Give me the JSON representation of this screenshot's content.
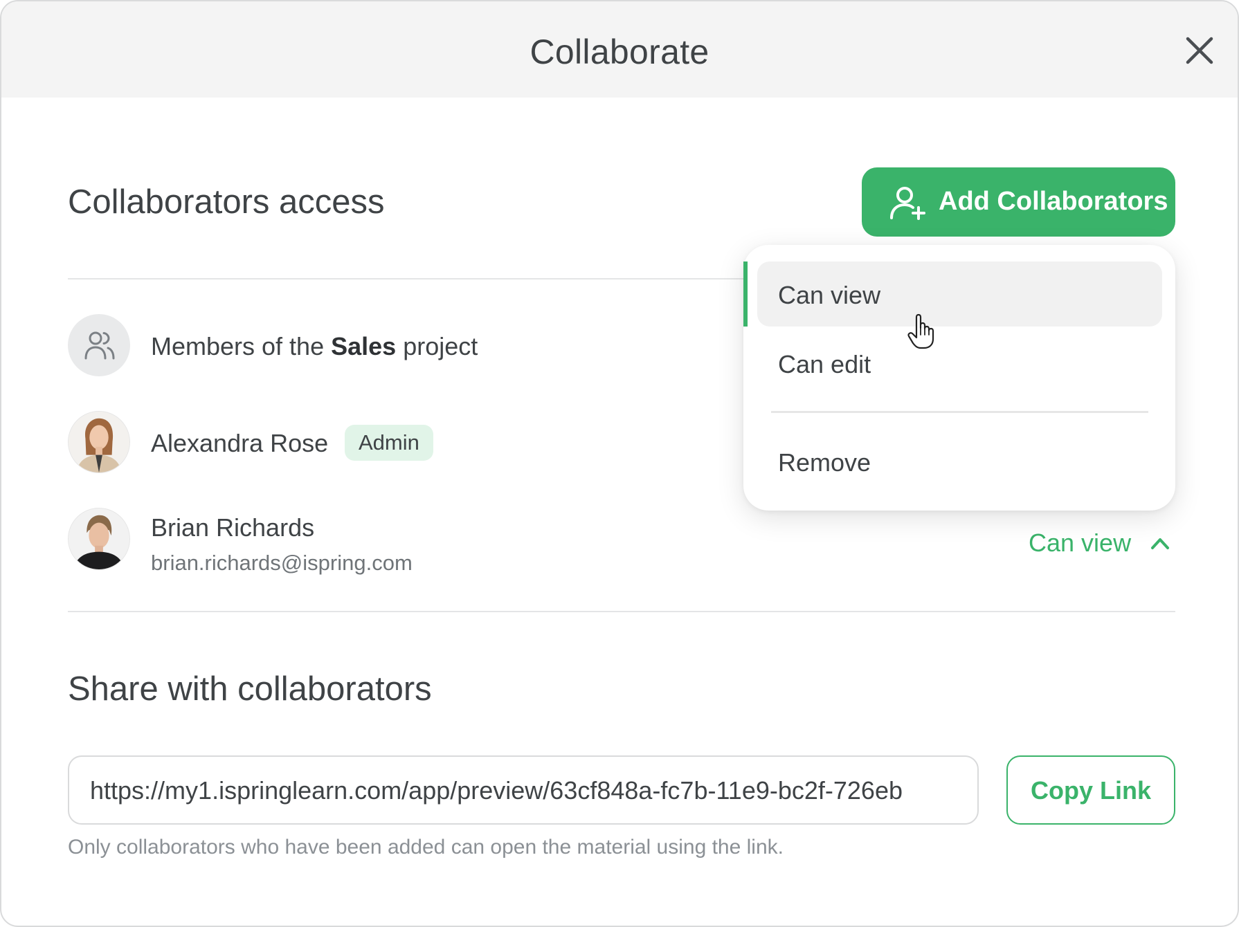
{
  "dialog": {
    "title": "Collaborate"
  },
  "access": {
    "title": "Collaborators access",
    "add_button_label": "Add Collaborators"
  },
  "collaborators": [
    {
      "prefix": "Members of the ",
      "bold": "Sales",
      "suffix": " project"
    },
    {
      "name": "Alexandra Rose",
      "badge": "Admin"
    },
    {
      "name": "Brian Richards",
      "email": "brian.richards@ispring.com",
      "role": "Can view"
    }
  ],
  "role_menu": {
    "items": [
      "Can view",
      "Can edit",
      "Remove"
    ],
    "selected": "Can view"
  },
  "share": {
    "title": "Share with collaborators",
    "link_value": "https://my1.ispringlearn.com/app/preview/63cf848a-fc7b-11e9-bc2f-726eb",
    "copy_label": "Copy Link",
    "hint": "Only collaborators who have been added can open the material using the link."
  },
  "colors": {
    "accent": "#3ab36a",
    "badge_bg": "#e1f4e8",
    "header_bg": "#f4f4f4"
  }
}
